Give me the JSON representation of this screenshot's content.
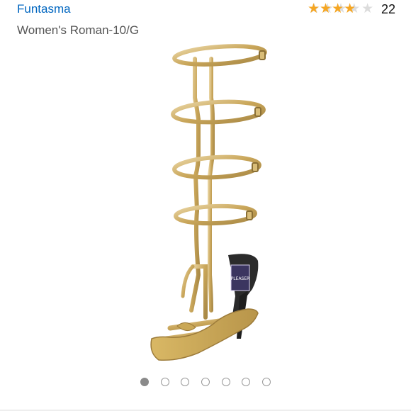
{
  "product": {
    "brand": "Funtasma",
    "title": "Women's Roman-10/G",
    "rating": {
      "stars_filled": 3.5,
      "stars_total": 5,
      "review_count": "22",
      "star_color": "#f5a623"
    },
    "image": {
      "subject": "gold-gladiator-sandal",
      "label_text": "PLEASER"
    }
  },
  "carousel": {
    "total": 7,
    "active_index": 0
  },
  "colors": {
    "link": "#0066c0",
    "gold": "#c8a85c"
  }
}
